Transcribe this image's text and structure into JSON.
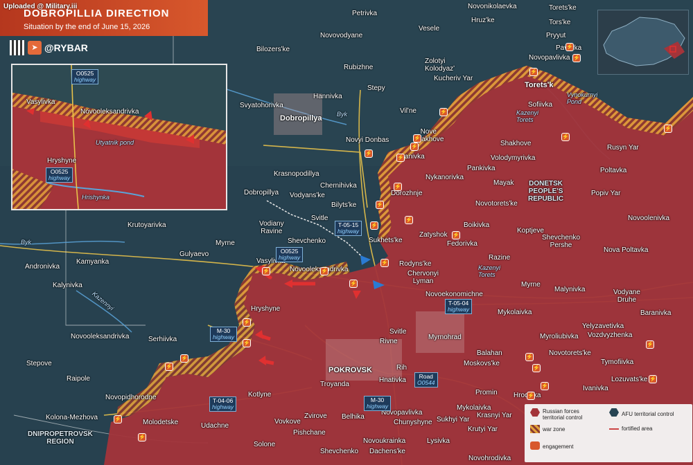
{
  "header": {
    "uploaded": "Uploaded @ Military.iii",
    "title": "DOBROPILLIA DIRECTION",
    "subtitle": "Situation by the end of June 15, 2026",
    "brand": "@RYBAR"
  },
  "places": {
    "petrivka": "Petrivka",
    "novonikolaevka": "Novonikolaevka",
    "toretske_top": "Toretsʹke",
    "novovodyane": "Novovodyane",
    "vesele": "Vesele",
    "hruzke": "Hruzʹke",
    "torske": "Torsʹke",
    "bilozerske": "Bilozersʹke",
    "zolotyi_kolodyaz": "Zolotyi\nKolodyazʹ",
    "pryyut": "Pryyut",
    "pavlivka": "Pavlivka",
    "novopavlivka": "Novopavlivka",
    "rubizhne": "Rubizhne",
    "kucheriv_yar": "Kucheriv Yar",
    "stepy": "Stepy",
    "toretsk": "Toretsʹk",
    "hannivka": "Hannivka",
    "svyatohorivka": "Svyatohorivka",
    "sofiivka": "Sofiivka",
    "dobropillya": "Dobropillya",
    "vilne": "Vilʹne",
    "nove_shakhove": "Nove\nShakhove",
    "shakhove": "Shakhove",
    "novyi_donbas": "Novyi Donbas",
    "ivanivka_n": "Ivanivka",
    "rusyn_yar": "Rusyn Yar",
    "poltavka": "Poltavka",
    "pankivka": "Pankivka",
    "volodymyrivka": "Volodymyrivka",
    "krasnopodillya": "Krasnopodillya",
    "nykanorivka": "Nykanorivka",
    "mayak": "Mayak",
    "chernihivka": "Chernihivka",
    "dobropillya_small": "Dobropillya",
    "vodyanske": "Vodyansʹke",
    "dorozhnje": "Dorozhnje",
    "popiv_yar": "Popiv Yar",
    "bilytske": "Bilytsʹke",
    "novotoretske": "Novotoretsʹke",
    "krutoyarivka": "Krutoyarivka",
    "svitle": "Svitle",
    "boikivka": "Boikivka",
    "novoolenivka": "Novoolenivka",
    "kopt_ieve": "Koptjeve",
    "zatyshok": "Zatyshok",
    "sukhetske": "Sukhetsʹke",
    "fedorivka": "Fedorivka",
    "shevchenko_pershe": "Shevchenko\nPershe",
    "shevchenko": "Shevchenko",
    "myrne_w": "Myrne",
    "gulyaevo": "Gulyaevo",
    "nova_poltavka": "Nova Poltavka",
    "andronivka": "Andronivka",
    "kamyanka": "Kamyanka",
    "rodynske": "Rodynsʹke",
    "razine": "Razine",
    "vasylivka": "Vasylivka",
    "novooleksandrivka": "Novooleksandrivka",
    "chervonyi_lyman": "Chervonyi\nLyman",
    "kalynivka": "Kalynivka",
    "myrne_e": "Myrne",
    "malynivka": "Malynivka",
    "vodyane_druhe": "Vodyane\nDruhe",
    "novoekonomichne": "Novoekonomichne",
    "hryshyne": "Hryshyne",
    "baranivka": "Baranivka",
    "mykolaivka_e": "Mykolaivka",
    "yelyzavetivka": "Yelyzavetivka",
    "svitle_s": "Svitle",
    "novooleksandrivka_w": "Novooleksandrivka",
    "serhiivka": "Serhiivka",
    "myrnohrad": "Myrnohrad",
    "myroliubivka": "Myroliubivka",
    "vozdvyzhenka": "Vozdvyzhenka",
    "rivne": "Rivne",
    "balahan": "Balahan",
    "novotoretske_s": "Novotoretsʹke",
    "stepove": "Stepove",
    "moskovske": "Moskovsʹke",
    "tymofiivka": "Tymofiivka",
    "rih": "Rih",
    "pokrovsk": "POKROVSK",
    "hnativka": "Hnativka",
    "raipole": "Raipole",
    "lozuvatske": "Lozuvatsʹke",
    "troyanda": "Troyanda",
    "promin": "Promin",
    "ivanivka_s": "Ivanivka",
    "hrodivka": "Hrodivka",
    "novopidhorodne": "Novopidhorodne",
    "kotlyne": "Kotlyne",
    "mykolaivka_s": "Mykolaivka",
    "krasnyi_yar": "Krasnyi Yar",
    "sukhyi_yar": "Sukhyi Yar",
    "kolona_mezhova": "Kolona-Mezhova",
    "molodetske": "Molodetske",
    "vovkove": "Vovkove",
    "zvirove": "Zvirove",
    "novopavlivka_s": "Novopavlivka",
    "chunyshyne": "Chunyshyne",
    "krutyi_yar": "Krutyi Yar",
    "udachne": "Udachne",
    "pishchane": "Pishchane",
    "belhika": "Belhika",
    "solone": "Solone",
    "novoukrainka": "Novoukrainka",
    "lysivka": "Lysivka",
    "shevchenko_s": "Shevchenko",
    "dachenske": "Dachensʹke",
    "novohrodivka": "Novohrodivka",
    "dnipro_region": "DNIPROPETROVSK\nREGION",
    "donetsk_republic": "DONETSK\nPEOPLE'S\nREPUBLIC",
    "vodiany_ravine": "Vodiany\nRavine"
  },
  "water": {
    "byk_w": "Byk",
    "byk_e": "Byk",
    "kazenyi_torets_n": "Kazenyi\nTorets",
    "kazenyi_torets_s": "Kazenyi\nTorets",
    "vynokurnyi_pond": "Vynokurnyi\nPond",
    "kazennyi_river": "Kazennyi"
  },
  "shields": {
    "o0525_main": {
      "code": "O0525",
      "type": "highway"
    },
    "t0515": {
      "code": "T-05-15",
      "type": "highway"
    },
    "t0504": {
      "code": "T-05-04",
      "type": "highway"
    },
    "m30_w": {
      "code": "M-30",
      "type": "highway"
    },
    "m30_s": {
      "code": "M-30",
      "type": "highway"
    },
    "road_o0544": {
      "code": "Road",
      "type": "O0544"
    },
    "t0406": {
      "code": "T-04-06",
      "type": "highway"
    }
  },
  "inset": {
    "o0525_top": {
      "code": "O0525",
      "type": "highway"
    },
    "o0525_bottom": {
      "code": "O0525",
      "type": "highway"
    },
    "vasylivka": "Vasylivka",
    "novooleksandrivka": "Novooleksandrivka",
    "utyatnik_pond": "Utyatnik pond",
    "hryshyne": "Hryshyne",
    "river": "Hrishynka"
  },
  "legend": {
    "russian": "Russian forces\nterritorial control",
    "afu": "AFU territorial control",
    "war_zone": "war zone",
    "fortified": "fortified area",
    "engagement": "engagement"
  },
  "colors": {
    "russian": "#a3343a",
    "afu": "#274453",
    "war_zone": "#e3a23a",
    "accent": "#d8582c"
  }
}
